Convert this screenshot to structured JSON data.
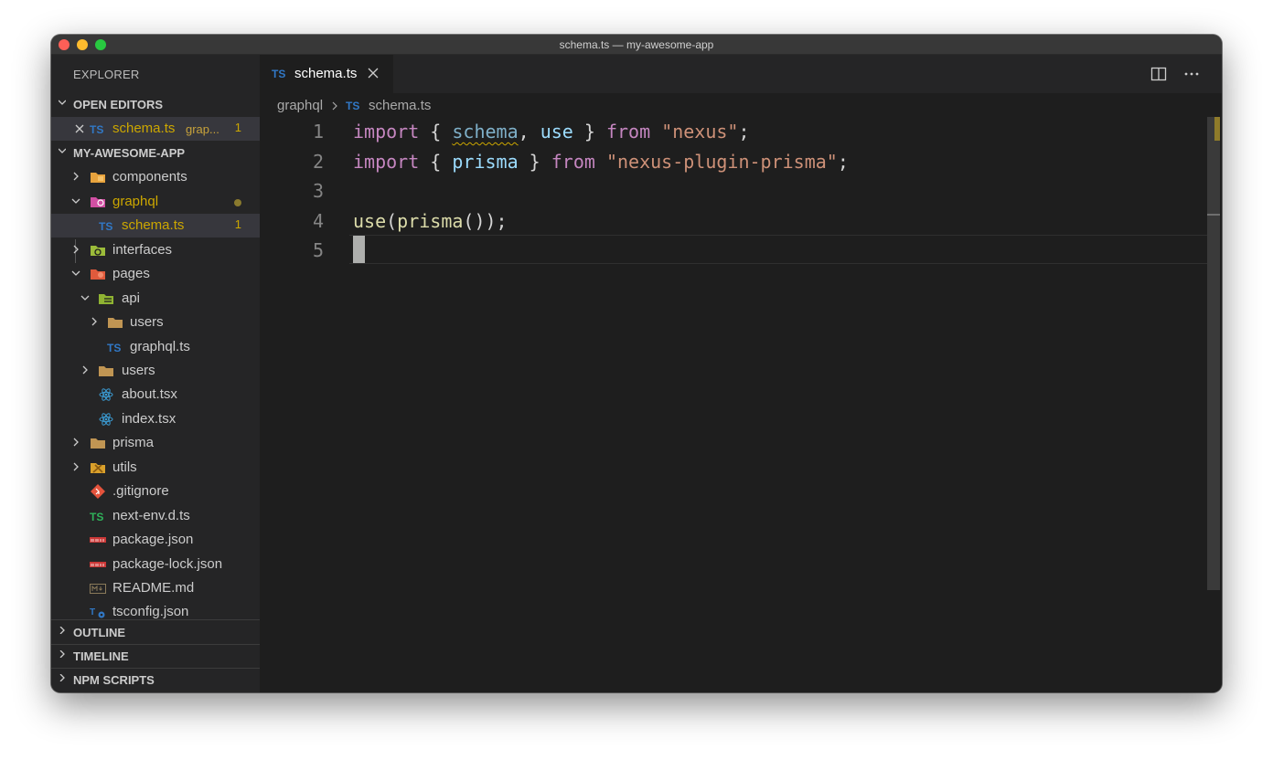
{
  "window": {
    "title": "schema.ts — my-awesome-app"
  },
  "sidebar": {
    "header": "EXPLORER",
    "open_editors": {
      "title": "OPEN EDITORS",
      "items": [
        {
          "name": "schema.ts",
          "path": "grap...",
          "badge": "1"
        }
      ]
    },
    "project": {
      "title": "MY-AWESOME-APP",
      "tree": [
        {
          "label": "components"
        },
        {
          "label": "graphql"
        },
        {
          "label": "schema.ts",
          "badge": "1"
        },
        {
          "label": "interfaces"
        },
        {
          "label": "pages"
        },
        {
          "label": "api"
        },
        {
          "label": "users"
        },
        {
          "label": "graphql.ts"
        },
        {
          "label": "users"
        },
        {
          "label": "about.tsx"
        },
        {
          "label": "index.tsx"
        },
        {
          "label": "prisma"
        },
        {
          "label": "utils"
        },
        {
          "label": ".gitignore"
        },
        {
          "label": "next-env.d.ts"
        },
        {
          "label": "package.json"
        },
        {
          "label": "package-lock.json"
        },
        {
          "label": "README.md"
        },
        {
          "label": "tsconfig.json"
        }
      ]
    },
    "bottom_sections": [
      "OUTLINE",
      "TIMELINE",
      "NPM SCRIPTS"
    ]
  },
  "tabs": [
    {
      "label": "schema.ts",
      "icon_text": "TS"
    }
  ],
  "breadcrumb": {
    "folder": "graphql",
    "icon_text": "TS",
    "file": "schema.ts"
  },
  "editor": {
    "line_numbers": [
      "1",
      "2",
      "3",
      "4",
      "5"
    ],
    "lines": [
      {
        "t1": "import",
        "t2": " { ",
        "t3": "schema",
        "t4": ", ",
        "t5": "use",
        "t6": " } ",
        "t7": "from",
        "t8": " ",
        "t9": "\"nexus\"",
        "t10": ";"
      },
      {
        "t1": "import",
        "t2": " { ",
        "t3": "prisma",
        "t4": " } ",
        "t5": "from",
        "t6": " ",
        "t7": "\"nexus-plugin-prisma\"",
        "t8": ";"
      },
      {},
      {
        "t1": "use",
        "t2": "(",
        "t3": "prisma",
        "t4": "());"
      }
    ]
  },
  "colors": {
    "keyword": "#c586c0",
    "identifier": "#9cdcfe",
    "string": "#ce9178",
    "function": "#dcdcaa",
    "warning": "#cca700"
  }
}
